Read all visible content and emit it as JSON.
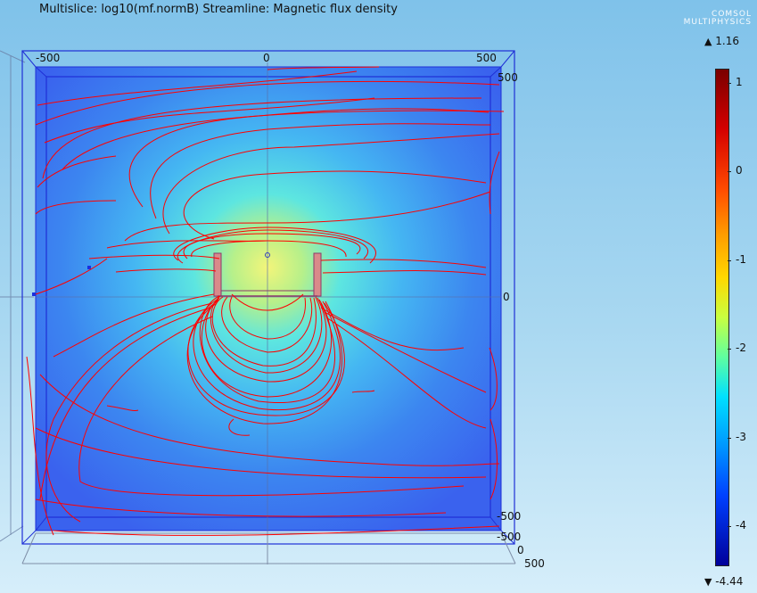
{
  "title": "Multislice: log10(mf.normB)  Streamline: Magnetic flux density",
  "logo": {
    "line1": "COMSOL",
    "line2": "MULTIPHYSICS"
  },
  "axes": {
    "x_top": [
      "-500",
      "0",
      "500"
    ],
    "y_right": [
      "500",
      "0",
      "-500"
    ],
    "bottom": [
      "-500",
      "0",
      "500"
    ]
  },
  "colorbar": {
    "max_label": "1.16",
    "min_label": "-4.44",
    "ticks": [
      "1",
      "0",
      "-1",
      "-2",
      "-3",
      "-4"
    ],
    "up_arrow": "▲",
    "down_arrow": "▼"
  },
  "colors": {
    "streamline": "#ff0000",
    "frame": "#1f2fd6",
    "field_low": "#3a5ff2",
    "field_high": "#e8f65a"
  }
}
